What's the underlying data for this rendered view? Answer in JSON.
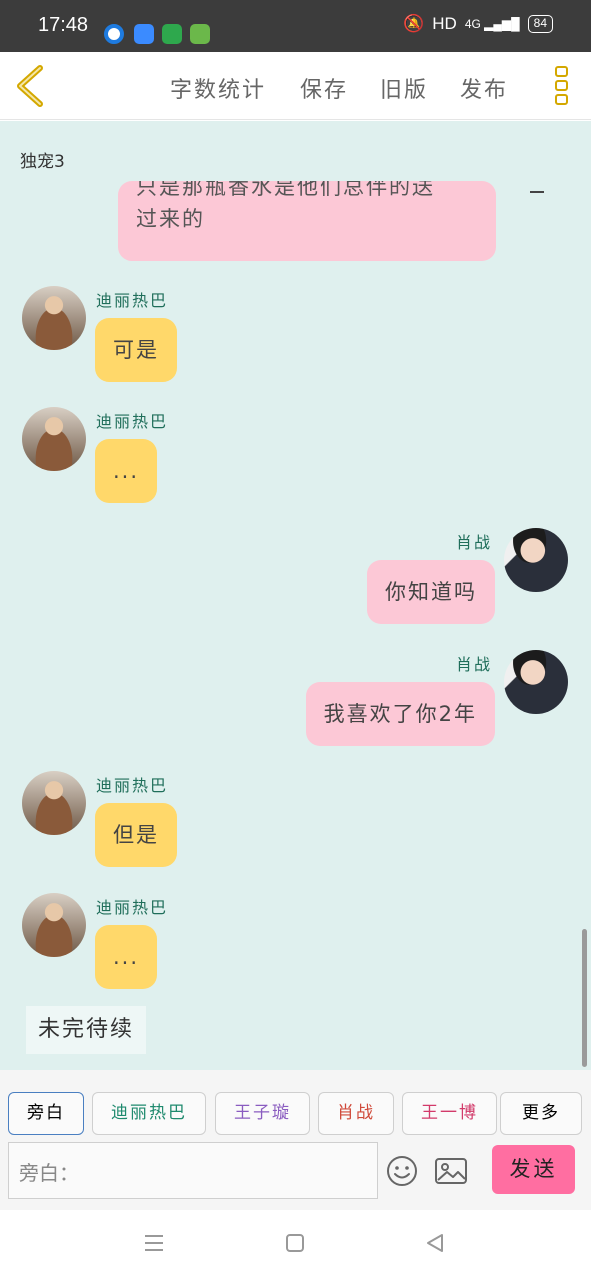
{
  "status_bar": {
    "time": "17:48",
    "network": "HD",
    "signal": "4G",
    "battery": "84"
  },
  "toolbar": {
    "word_count": "字数统计",
    "save": "保存",
    "old_version": "旧版",
    "publish": "发布"
  },
  "chat": {
    "title": "独宠3",
    "partial_message": {
      "line1": "只是那瓶香水是他们总伴的送",
      "line2": "过来的"
    },
    "messages": [
      {
        "sender": "迪丽热巴",
        "text": "可是",
        "side": "left"
      },
      {
        "sender": "迪丽热巴",
        "text": "...",
        "side": "left"
      },
      {
        "sender": "肖战",
        "text": "你知道吗",
        "side": "right"
      },
      {
        "sender": "肖战",
        "text": "我喜欢了你2年",
        "side": "right"
      },
      {
        "sender": "迪丽热巴",
        "text": "但是",
        "side": "left"
      },
      {
        "sender": "迪丽热巴",
        "text": "...",
        "side": "left"
      }
    ],
    "to_be_continued": "未完待续"
  },
  "input": {
    "characters": [
      {
        "label": "旁白",
        "color": "#555555"
      },
      {
        "label": "迪丽热巴",
        "color": "#1f8a6e"
      },
      {
        "label": "王子璇",
        "color": "#8a5cc0"
      },
      {
        "label": "肖战",
        "color": "#d04a3a"
      },
      {
        "label": "王一博",
        "color": "#d23a6a"
      },
      {
        "label": "更多",
        "color": "#555555"
      }
    ],
    "placeholder": "旁白：",
    "send": "发送"
  },
  "colors": {
    "chat_bg": "#dff0ee",
    "left_bubble": "#ffd86a",
    "right_bubble": "#fcc8d6",
    "send_button": "#ff6ea1",
    "name_color": "#1f6e5a"
  }
}
